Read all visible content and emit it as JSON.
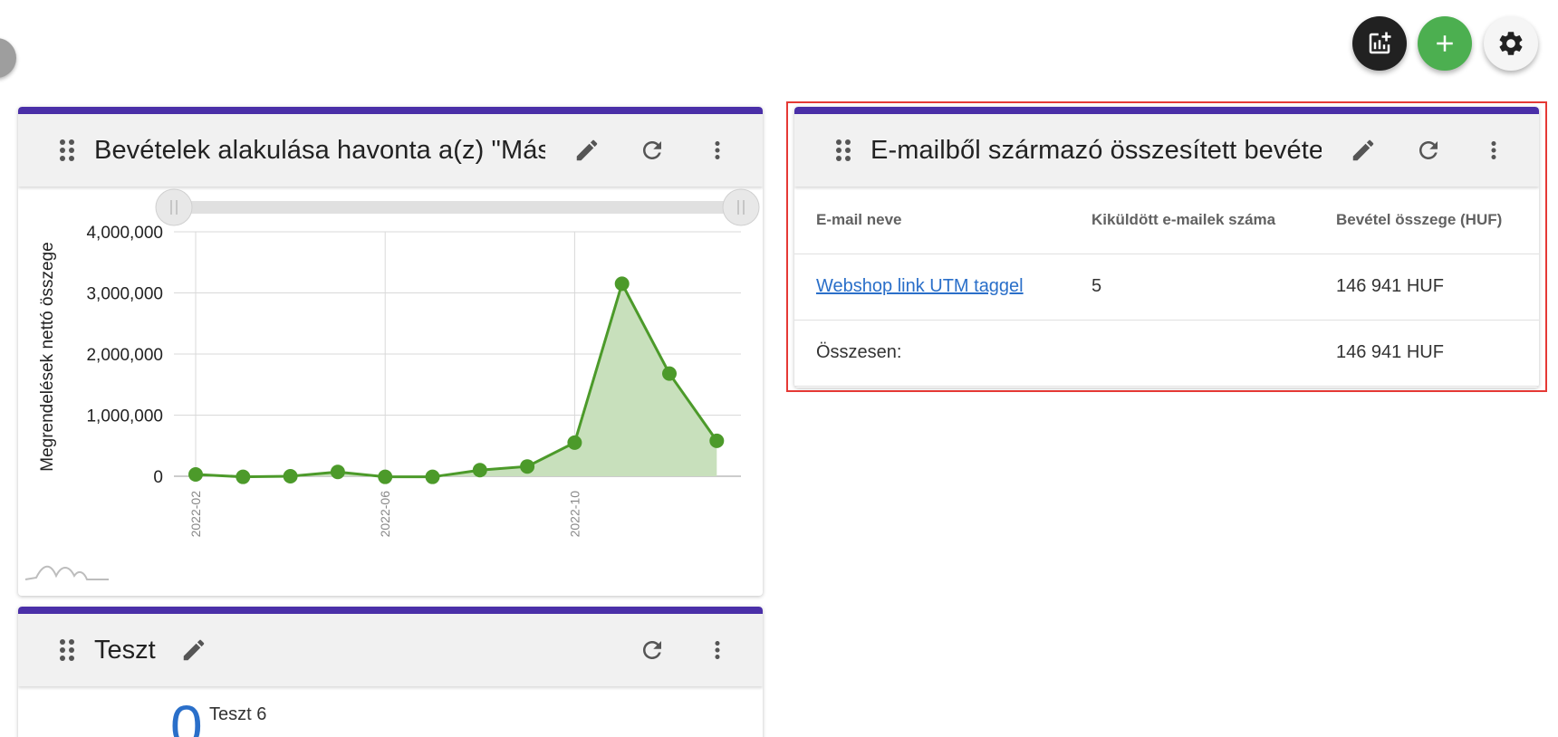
{
  "fabs": {
    "add_chart": "add-chart-icon",
    "add": "plus-icon",
    "settings": "gear-icon"
  },
  "chart_card": {
    "title": "Bevételek alakulása havonta a(z) \"Más"
  },
  "chart_data": {
    "type": "area",
    "ylabel": "Megrendelések nettó összege",
    "xlabel": "",
    "x": [
      "2022-02",
      "2022-03",
      "2022-04",
      "2022-05",
      "2022-06",
      "2022-07",
      "2022-08",
      "2022-09",
      "2022-10",
      "2022-11",
      "2022-12",
      "2023-01"
    ],
    "x_tick_labels": [
      "2022-02",
      "2022-06",
      "2022-10"
    ],
    "values": [
      30000,
      -10000,
      0,
      70000,
      -10000,
      -10000,
      100000,
      160000,
      550000,
      3150000,
      1680000,
      580000
    ],
    "ylim": [
      0,
      4000000
    ],
    "y_tick_labels": [
      "4,000,000",
      "3,000,000",
      "2,000,000",
      "1,000,000",
      "0"
    ],
    "y_ticks": [
      4000000,
      3000000,
      2000000,
      1000000,
      0
    ],
    "grid": true,
    "color": "#4c9a2a",
    "fill_color": "#c8e0bc"
  },
  "email_card": {
    "title": "E-mailből származó összesített bevéte",
    "headers": [
      "E-mail neve",
      "Kiküldött e-mailek száma",
      "Bevétel összege (HUF)"
    ],
    "rows": [
      {
        "name": "Webshop link UTM taggel",
        "sent": "5",
        "revenue": "146 941 HUF"
      }
    ],
    "total_label": "Összesen:",
    "total_revenue": "146 941 HUF"
  },
  "teszt_card": {
    "title": "Teszt",
    "big_value": "0",
    "label": "Teszt 6"
  },
  "colors": {
    "accent": "#4a2fa8",
    "highlight": "#e53935",
    "link": "#2a6fc9",
    "green": "#4caf50"
  }
}
